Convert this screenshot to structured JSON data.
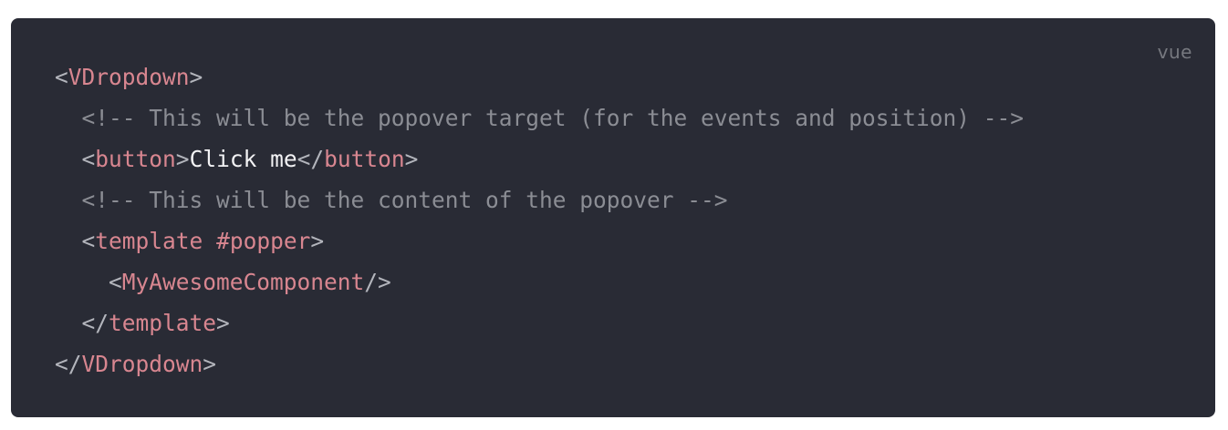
{
  "code_block": {
    "language": "vue",
    "lines": [
      [
        {
          "cls": "punct",
          "text": "<"
        },
        {
          "cls": "tag",
          "text": "VDropdown"
        },
        {
          "cls": "punct",
          "text": ">"
        }
      ],
      [
        {
          "cls": "text",
          "text": "  "
        },
        {
          "cls": "comment",
          "text": "<!-- This will be the popover target (for the events and position) -->"
        }
      ],
      [
        {
          "cls": "text",
          "text": "  "
        },
        {
          "cls": "punct",
          "text": "<"
        },
        {
          "cls": "tag",
          "text": "button"
        },
        {
          "cls": "punct",
          "text": ">"
        },
        {
          "cls": "text",
          "text": "Click me"
        },
        {
          "cls": "punct",
          "text": "</"
        },
        {
          "cls": "tag",
          "text": "button"
        },
        {
          "cls": "punct",
          "text": ">"
        }
      ],
      [
        {
          "cls": "text",
          "text": "  "
        },
        {
          "cls": "comment",
          "text": "<!-- This will be the content of the popover -->"
        }
      ],
      [
        {
          "cls": "text",
          "text": "  "
        },
        {
          "cls": "punct",
          "text": "<"
        },
        {
          "cls": "tag",
          "text": "template"
        },
        {
          "cls": "text",
          "text": " "
        },
        {
          "cls": "attr",
          "text": "#popper"
        },
        {
          "cls": "punct",
          "text": ">"
        }
      ],
      [
        {
          "cls": "text",
          "text": "    "
        },
        {
          "cls": "punct",
          "text": "<"
        },
        {
          "cls": "tag",
          "text": "MyAwesomeComponent"
        },
        {
          "cls": "punct",
          "text": "/>"
        }
      ],
      [
        {
          "cls": "text",
          "text": "  "
        },
        {
          "cls": "punct",
          "text": "</"
        },
        {
          "cls": "tag",
          "text": "template"
        },
        {
          "cls": "punct",
          "text": ">"
        }
      ],
      [
        {
          "cls": "punct",
          "text": "</"
        },
        {
          "cls": "tag",
          "text": "VDropdown"
        },
        {
          "cls": "punct",
          "text": ">"
        }
      ]
    ]
  },
  "colors": {
    "background": "#292b35",
    "tag": "#d88690",
    "comment": "#8b8d94",
    "punctuation": "#b3b5bc",
    "text": "#f2f2f4",
    "language_label": "#76787f"
  }
}
